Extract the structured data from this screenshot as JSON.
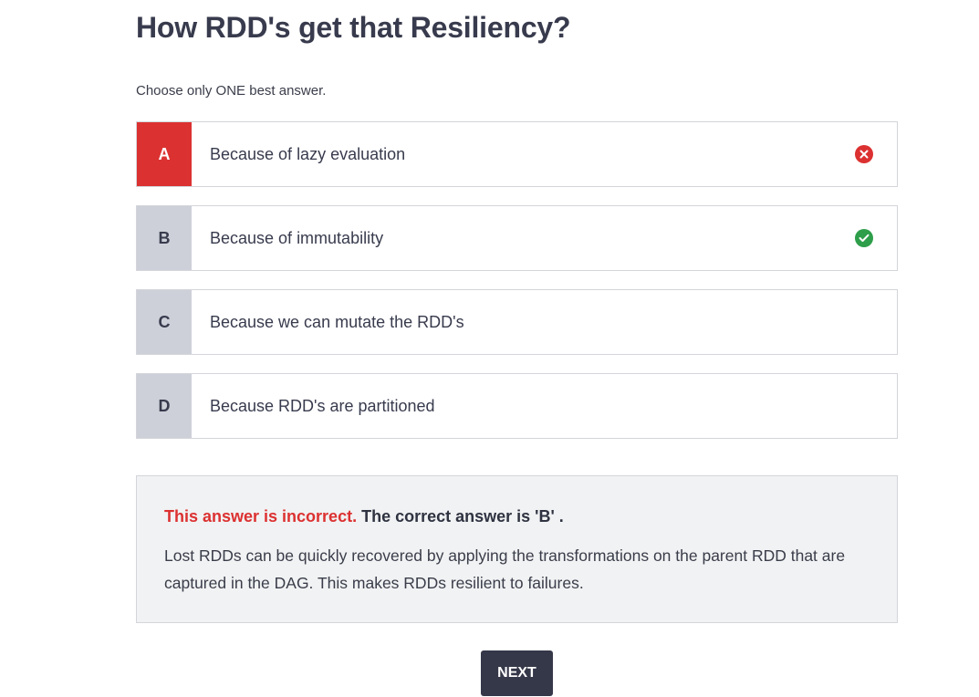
{
  "question": {
    "title": "How RDD's get that Resiliency?",
    "instruction": "Choose only ONE best answer."
  },
  "options": [
    {
      "letter": "A",
      "text": "Because of lazy evaluation",
      "status": "wrong",
      "status_icon": "x-circle-icon"
    },
    {
      "letter": "B",
      "text": "Because of immutability",
      "status": "correct",
      "status_icon": "check-circle-icon"
    },
    {
      "letter": "C",
      "text": "Because we can mutate the RDD's",
      "status": "none"
    },
    {
      "letter": "D",
      "text": "Because RDD's are partitioned",
      "status": "none"
    }
  ],
  "feedback": {
    "incorrect_label": "This answer is incorrect.",
    "correct_answer_text": "The correct answer is 'B' .",
    "explanation": "Lost RDDs can be quickly recovered by applying the transformations on the parent RDD that are captured in the DAG. This makes RDDs resilient to failures."
  },
  "actions": {
    "next_label": "NEXT"
  },
  "colors": {
    "wrong": "#dc3131",
    "correct": "#2e9e4a",
    "letter_bg": "#cdd0d8",
    "button_bg": "#353849",
    "feedback_bg": "#f1f2f3"
  }
}
